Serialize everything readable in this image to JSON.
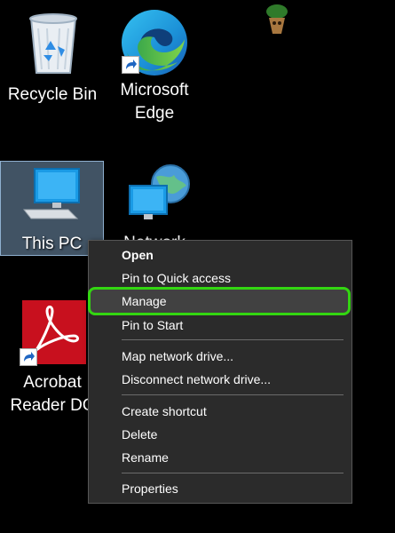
{
  "desktop": {
    "icons": [
      {
        "id": "recycle-bin",
        "label": "Recycle Bin"
      },
      {
        "id": "edge",
        "label_line1": "Microsoft",
        "label_line2": "Edge"
      },
      {
        "id": "this-pc",
        "label": "This PC",
        "selected": true
      },
      {
        "id": "network",
        "label": "Network"
      },
      {
        "id": "acrobat",
        "label_line1": "Acrobat",
        "label_line2": "Reader DC"
      }
    ]
  },
  "context_menu": {
    "items": [
      {
        "label": "Open",
        "bold": true
      },
      {
        "label": "Pin to Quick access"
      },
      {
        "label": "Manage",
        "highlighted": true
      },
      {
        "label": "Pin to Start"
      },
      {
        "label": "Map network drive..."
      },
      {
        "label": "Disconnect network drive..."
      },
      {
        "label": "Create shortcut"
      },
      {
        "label": "Delete"
      },
      {
        "label": "Rename"
      },
      {
        "label": "Properties"
      }
    ]
  },
  "colors": {
    "highlight_border": "#33d611",
    "menu_background": "#2b2b2b",
    "selection": "#7698b6"
  }
}
